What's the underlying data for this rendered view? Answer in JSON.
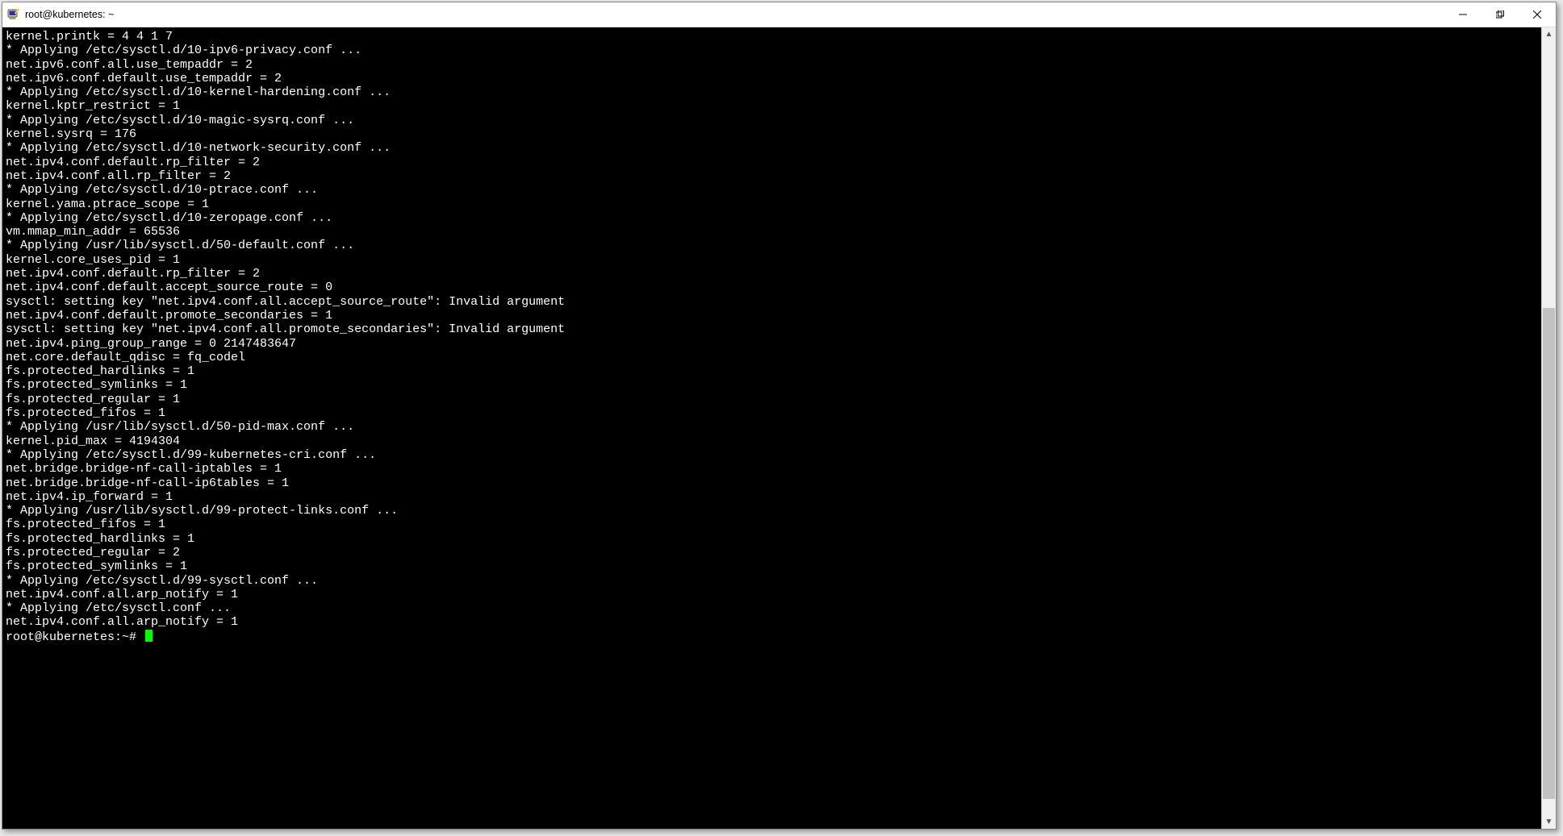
{
  "titlebar": {
    "title": "root@kubernetes: ~"
  },
  "terminal": {
    "lines": [
      "kernel.printk = 4 4 1 7",
      "* Applying /etc/sysctl.d/10-ipv6-privacy.conf ...",
      "net.ipv6.conf.all.use_tempaddr = 2",
      "net.ipv6.conf.default.use_tempaddr = 2",
      "* Applying /etc/sysctl.d/10-kernel-hardening.conf ...",
      "kernel.kptr_restrict = 1",
      "* Applying /etc/sysctl.d/10-magic-sysrq.conf ...",
      "kernel.sysrq = 176",
      "* Applying /etc/sysctl.d/10-network-security.conf ...",
      "net.ipv4.conf.default.rp_filter = 2",
      "net.ipv4.conf.all.rp_filter = 2",
      "* Applying /etc/sysctl.d/10-ptrace.conf ...",
      "kernel.yama.ptrace_scope = 1",
      "* Applying /etc/sysctl.d/10-zeropage.conf ...",
      "vm.mmap_min_addr = 65536",
      "* Applying /usr/lib/sysctl.d/50-default.conf ...",
      "kernel.core_uses_pid = 1",
      "net.ipv4.conf.default.rp_filter = 2",
      "net.ipv4.conf.default.accept_source_route = 0",
      "sysctl: setting key \"net.ipv4.conf.all.accept_source_route\": Invalid argument",
      "net.ipv4.conf.default.promote_secondaries = 1",
      "sysctl: setting key \"net.ipv4.conf.all.promote_secondaries\": Invalid argument",
      "net.ipv4.ping_group_range = 0 2147483647",
      "net.core.default_qdisc = fq_codel",
      "fs.protected_hardlinks = 1",
      "fs.protected_symlinks = 1",
      "fs.protected_regular = 1",
      "fs.protected_fifos = 1",
      "* Applying /usr/lib/sysctl.d/50-pid-max.conf ...",
      "kernel.pid_max = 4194304",
      "* Applying /etc/sysctl.d/99-kubernetes-cri.conf ...",
      "net.bridge.bridge-nf-call-iptables = 1",
      "net.bridge.bridge-nf-call-ip6tables = 1",
      "net.ipv4.ip_forward = 1",
      "* Applying /usr/lib/sysctl.d/99-protect-links.conf ...",
      "fs.protected_fifos = 1",
      "fs.protected_hardlinks = 1",
      "fs.protected_regular = 2",
      "fs.protected_symlinks = 1",
      "* Applying /etc/sysctl.d/99-sysctl.conf ...",
      "net.ipv4.conf.all.arp_notify = 1",
      "* Applying /etc/sysctl.conf ...",
      "net.ipv4.conf.all.arp_notify = 1"
    ],
    "prompt": "root@kubernetes:~#"
  },
  "scrollbar": {
    "thumb_top_pct": 35,
    "thumb_height_pct": 63
  }
}
